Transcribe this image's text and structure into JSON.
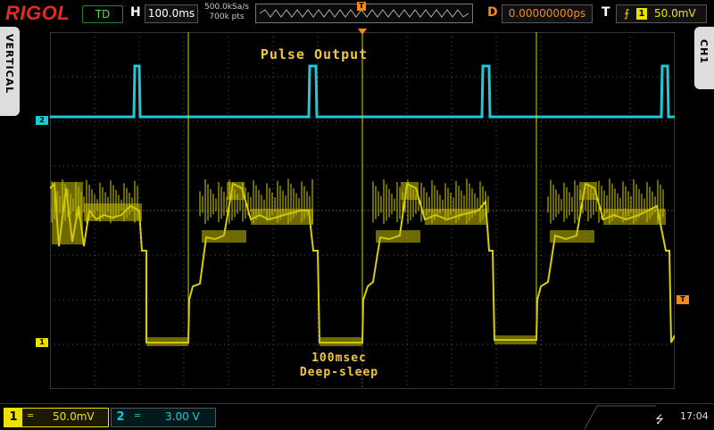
{
  "brand": "RIGOL",
  "header": {
    "run_state": "TD",
    "h_label": "H",
    "timebase": "100.0ms",
    "sample_rate": "500.0kSa/s",
    "mem_depth": "700k pts",
    "trigger_marker": "T",
    "d_label": "D",
    "delay": "0.00000000ps",
    "t_label": "T",
    "trigger_edge": "⨍",
    "trigger_channel": "1",
    "trigger_level": "50.0mV"
  },
  "side_tabs": {
    "left": "VERTICAL",
    "right": "CH1"
  },
  "channel_markers": {
    "ch1": "1",
    "ch2": "2",
    "trigger_level_marker": "T"
  },
  "annotations": {
    "pulse_output": "Pulse Output",
    "sleep_line1": "100msec",
    "sleep_line2": "Deep-sleep"
  },
  "footer": {
    "ch1": {
      "num": "1",
      "coupling": "═",
      "scale": "50.0mV"
    },
    "ch2": {
      "num": "2",
      "coupling": "═",
      "scale": "3.00 V"
    },
    "usb": "⭍",
    "time": "17:04"
  },
  "colors": {
    "ch1": "#f0e000",
    "ch2": "#1ec8d6",
    "trigger": "#f08a1c",
    "brand": "#e32b24"
  }
}
